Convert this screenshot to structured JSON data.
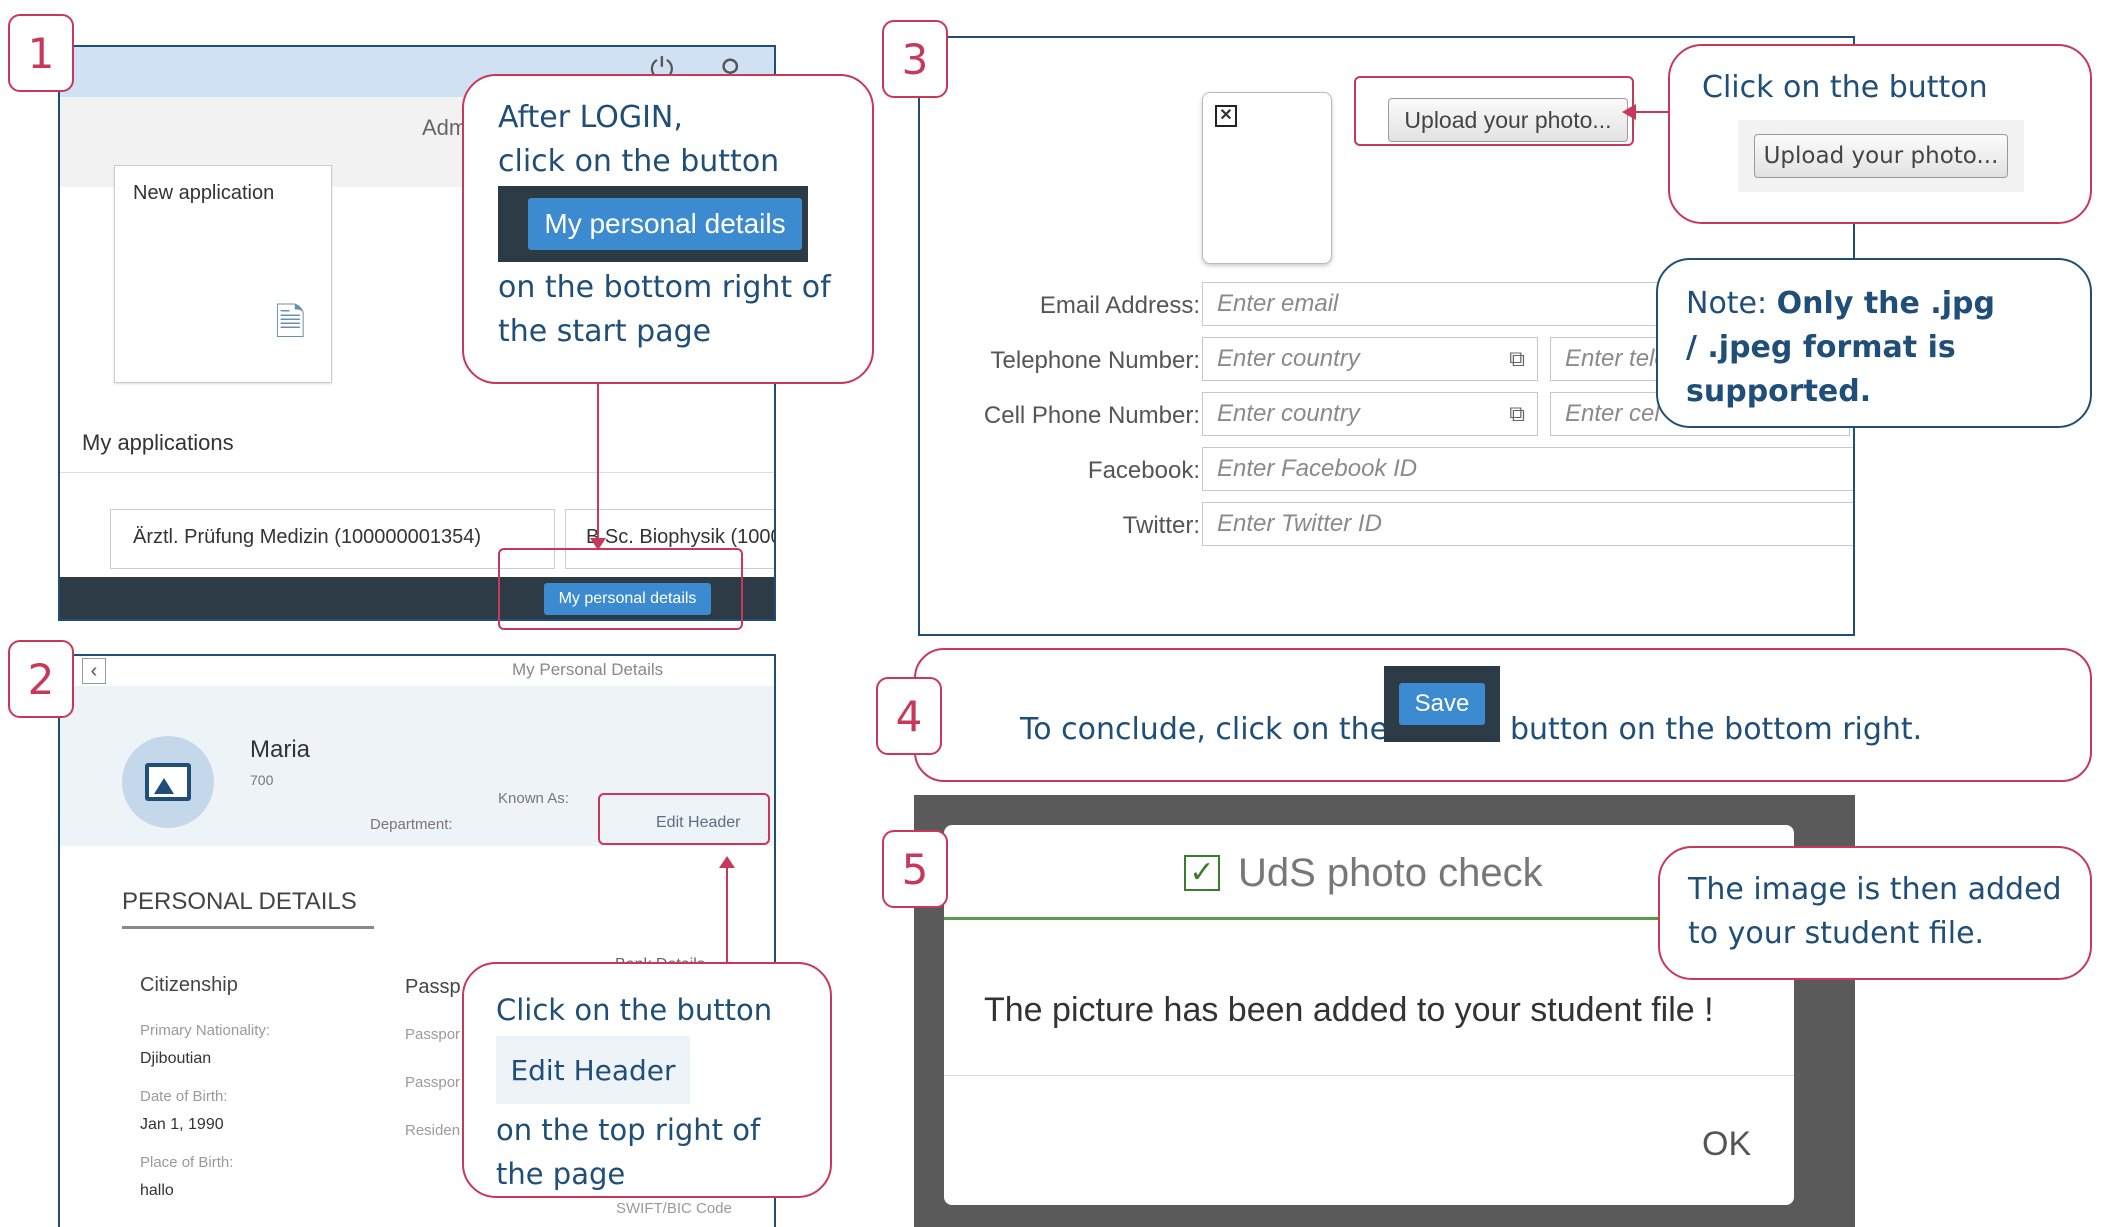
{
  "steps": [
    "1",
    "2",
    "3",
    "4",
    "5"
  ],
  "panel1": {
    "header_partial": "Adm",
    "tile_label": "New application",
    "section_title": "My applications",
    "app1": "Ärztl. Prüfung Medizin (100000001354)",
    "app2": "B.Sc. Biophysik (1000",
    "footer_button": "My personal details"
  },
  "callout1": {
    "line1": "After LOGIN,",
    "line2": "click on the button",
    "button": "My personal details",
    "line3": "on the bottom right of",
    "line4": "the start page"
  },
  "panel2": {
    "back_icon": "chevron-left-icon",
    "page_title": "My Personal Details",
    "name": "Maria",
    "id": "700",
    "known_as_label": "Known As:",
    "department_label": "Department:",
    "edit_header": "Edit Header",
    "section_title": "PERSONAL DETAILS",
    "citizenship_title": "Citizenship",
    "passport_title": "Passp",
    "primary_nationality_label": "Primary Nationality:",
    "primary_nationality_value": "Djiboutian",
    "dob_label": "Date of Birth:",
    "dob_value": "Jan 1, 1990",
    "pob_label": "Place of Birth:",
    "pob_value": "hallo",
    "passport_label1": "Passpor",
    "passport_label2": "Passpor",
    "resident_label": "Residen",
    "bank_partial": "Bank Details",
    "swift_partial": "SWIFT/BIC Code"
  },
  "callout2": {
    "line1": "Click on the button",
    "button": "Edit Header",
    "line2": "on the top right of",
    "line3": "the page"
  },
  "panel3": {
    "upload_button": "Upload your photo...",
    "email_label": "Email Address:",
    "email_placeholder": "Enter email",
    "tel_label": "Telephone Number:",
    "tel_country_placeholder": "Enter country",
    "tel_number_placeholder": "Enter tele",
    "cell_label": "Cell Phone Number:",
    "cell_country_placeholder": "Enter country",
    "cell_number_placeholder": "Enter cel",
    "facebook_label": "Facebook:",
    "facebook_placeholder": "Enter Facebook ID",
    "twitter_label": "Twitter:",
    "twitter_placeholder": "Enter Twitter ID"
  },
  "callout3": {
    "line1": "Click on the button",
    "button": "Upload your photo..."
  },
  "note3": {
    "prefix": "Note: ",
    "bold1": "Only the .jpg",
    "bold2": "/ .jpeg format is",
    "bold3": "supported."
  },
  "step4": {
    "before": "To conclude, click on the",
    "button": "Save",
    "after": "button on the bottom right."
  },
  "panel5": {
    "dialog_title": "UdS photo check",
    "message": "The picture has been added to your student file !",
    "ok": "OK"
  },
  "callout5": {
    "line1": "The image is then added",
    "line2": "to your student file."
  },
  "colors": {
    "accent": "#c8385a",
    "navy": "#1f4e79",
    "sap_blue": "#428bca"
  }
}
